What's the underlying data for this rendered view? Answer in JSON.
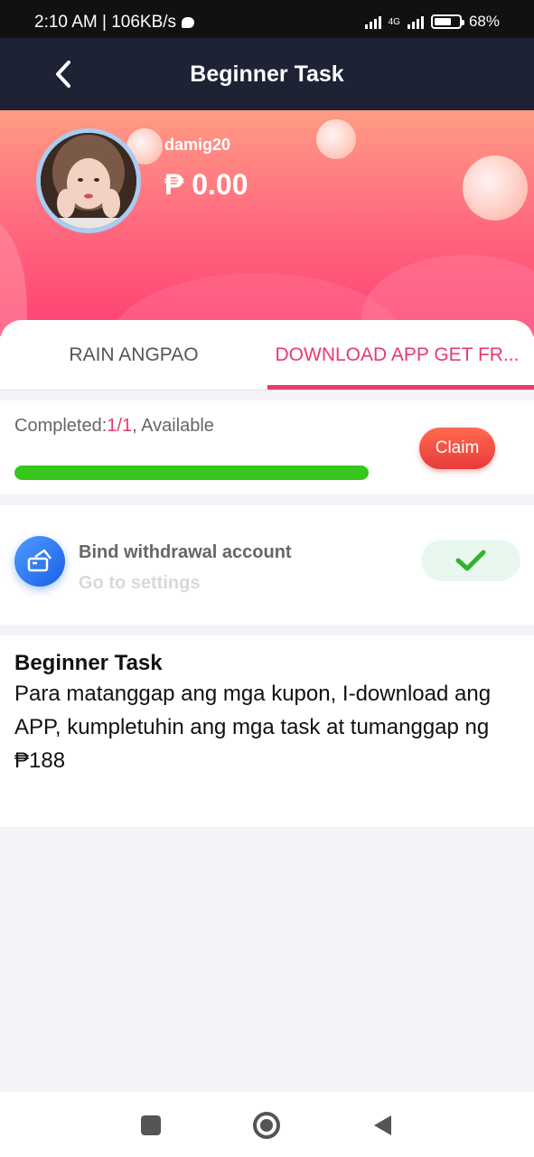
{
  "status_bar": {
    "time_speed": "2:10 AM | 106KB/s",
    "network": "4G",
    "battery": "68%"
  },
  "header": {
    "title": "Beginner Task"
  },
  "profile": {
    "username": "damig20",
    "balance": "₱ 0.00"
  },
  "tabs": [
    {
      "label": "RAIN ANGPAO",
      "active": false
    },
    {
      "label": "DOWNLOAD APP GET FR...",
      "active": true
    }
  ],
  "progress": {
    "completed_label": "Completed:",
    "completed_value": "1/1",
    "status_text": ", Available",
    "fraction": 1.0,
    "claim_label": "Claim",
    "bar_color": "#36c61d"
  },
  "task": {
    "title": "Bind withdrawal account",
    "subtitle": "Go to settings",
    "icon": "bank-card-icon",
    "status_icon": "checkmark-icon"
  },
  "description": {
    "title": "Beginner Task",
    "body": "Para matanggap ang mga kupon, I-download ang APP, kumpletuhin ang mga task at tumanggap ng ₱188"
  },
  "colors": {
    "accent": "#e83a6a",
    "header_bg": "#1e2235",
    "success": "#36c61d"
  }
}
